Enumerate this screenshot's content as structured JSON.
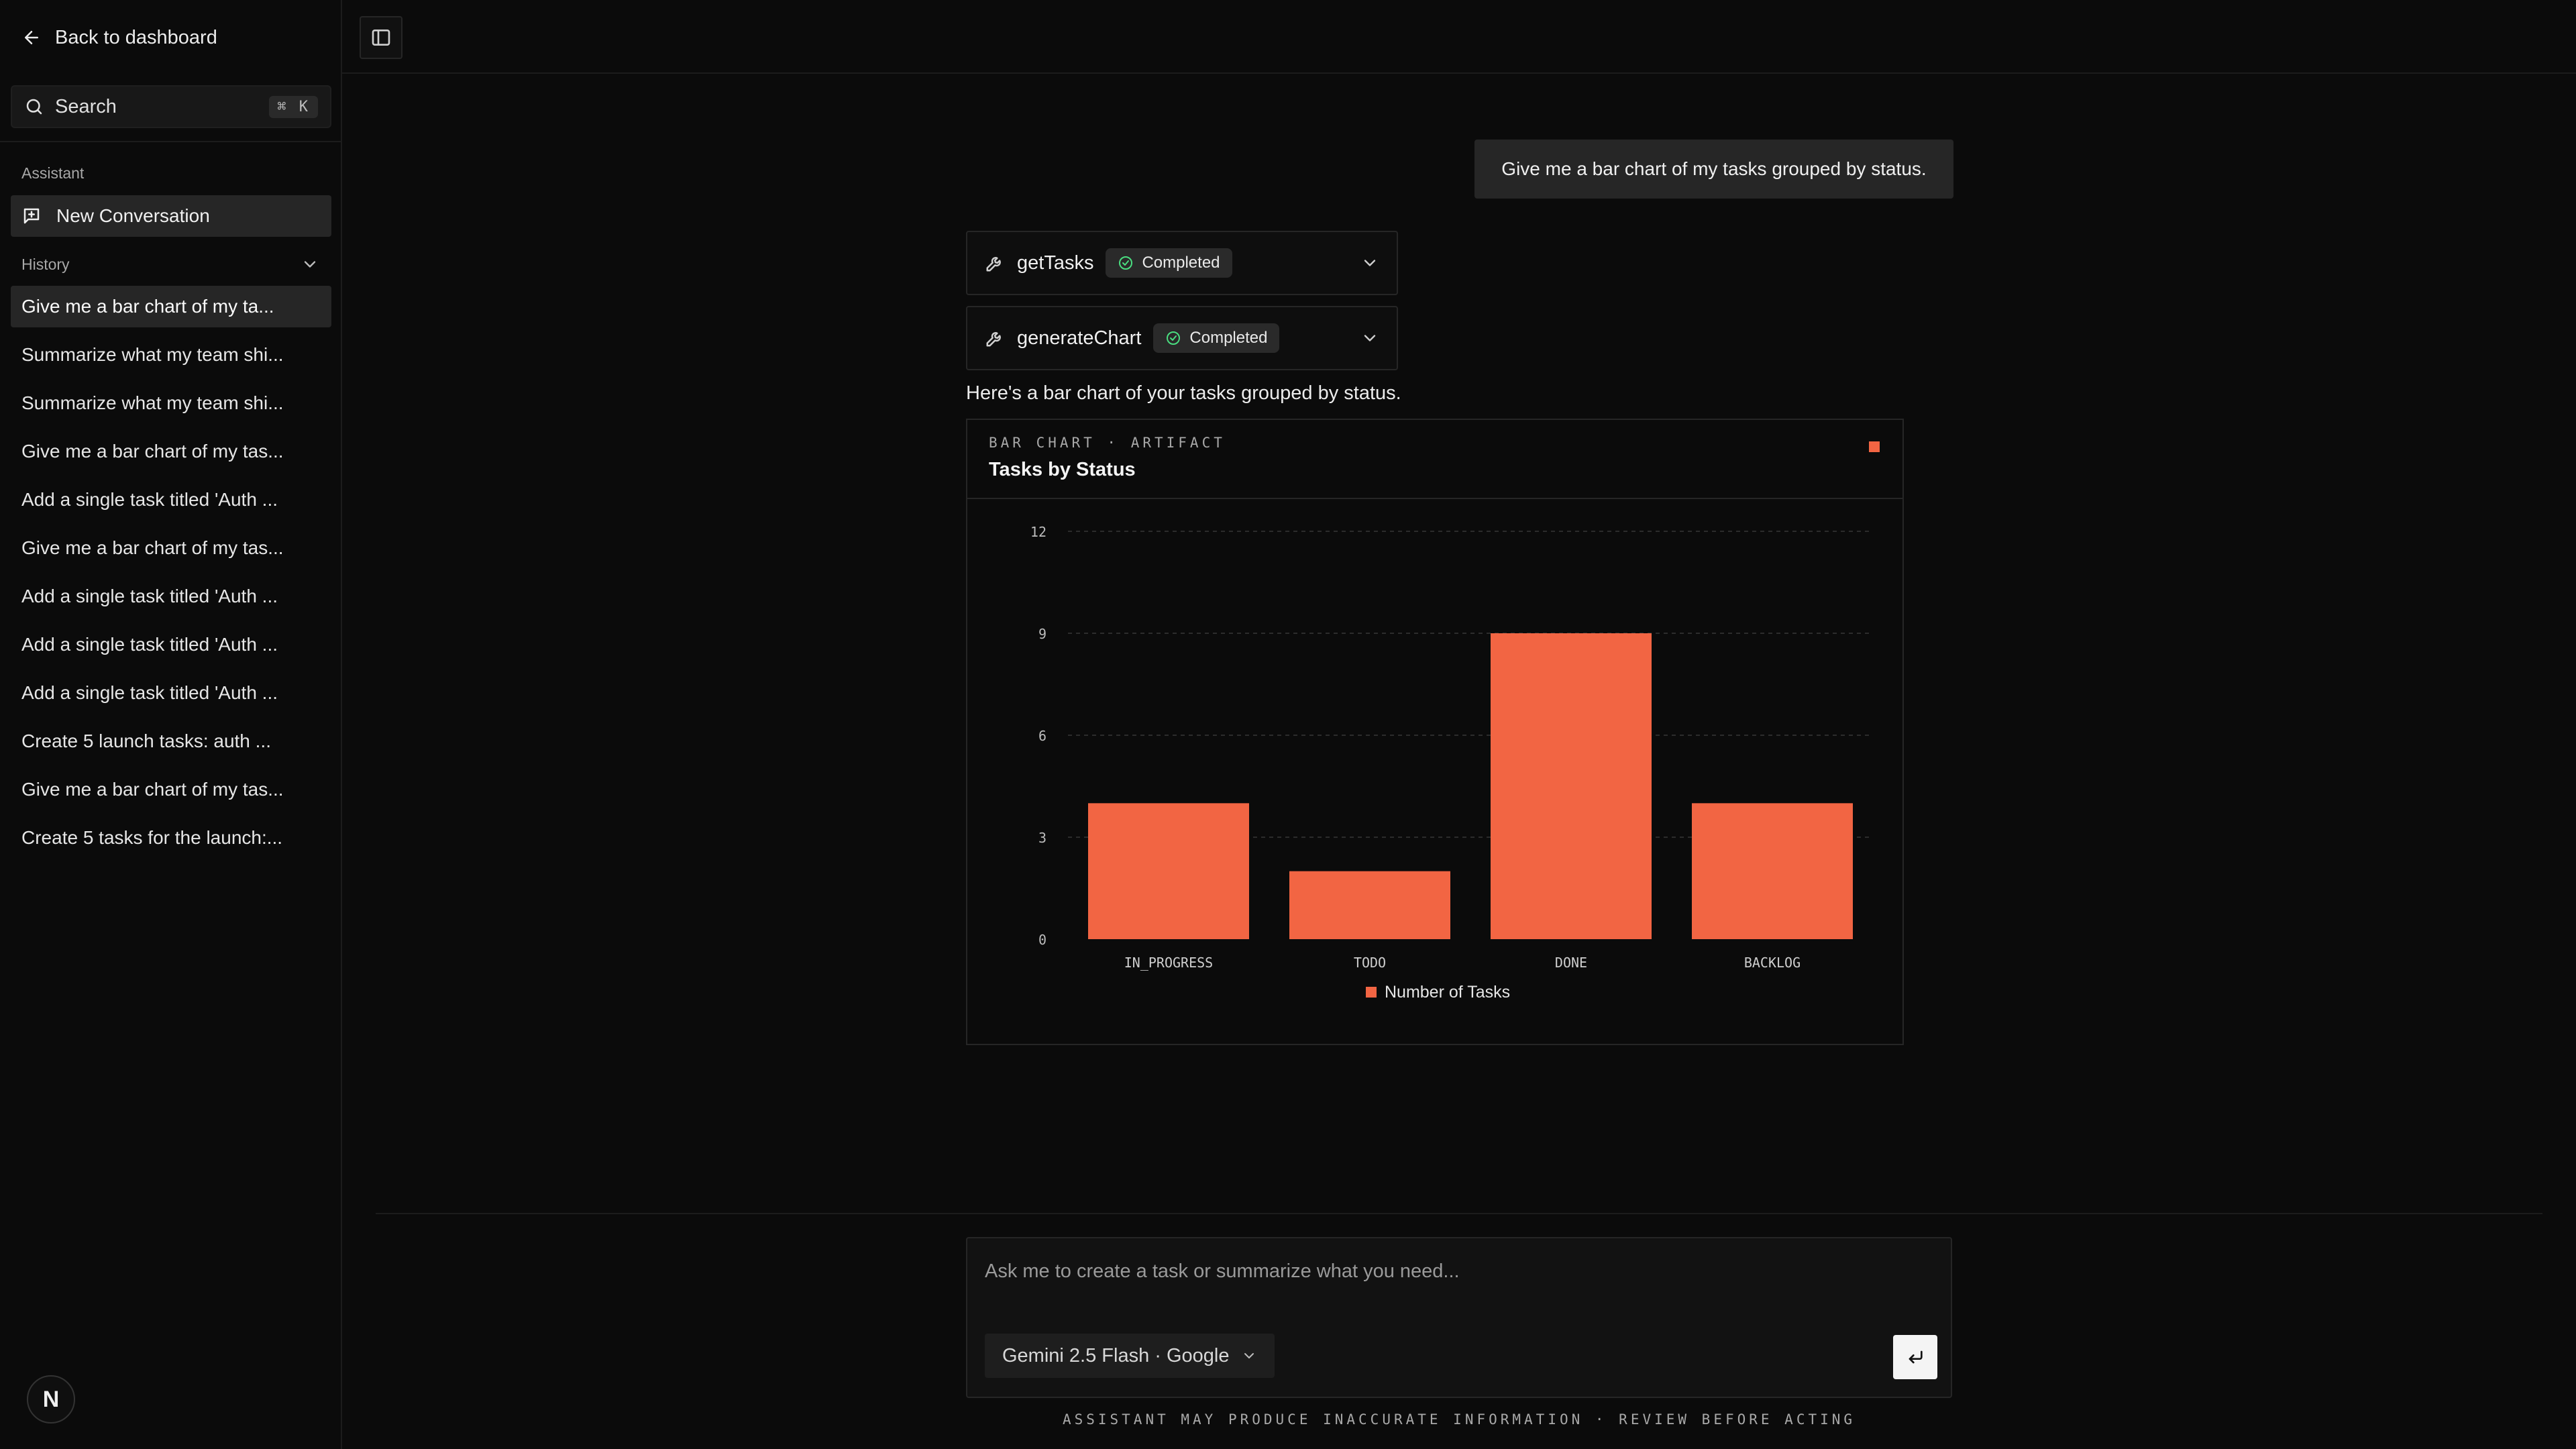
{
  "sidebar": {
    "back_label": "Back to dashboard",
    "search_label": "Search",
    "search_shortcut": "⌘ K",
    "assistant_section": "Assistant",
    "new_conversation": "New Conversation",
    "history_section": "History",
    "history": [
      "Give me a bar chart of my ta...",
      "Summarize what my team shi...",
      "Summarize what my team shi...",
      "Give me a bar chart of my tas...",
      "Add a single task titled 'Auth ...",
      "Give me a bar chart of my tas...",
      "Add a single task titled 'Auth ...",
      "Add a single task titled 'Auth ...",
      "Add a single task titled 'Auth ...",
      "Create 5 launch tasks: auth ...",
      "Give me a bar chart of my tas...",
      "Create 5 tasks for the launch:..."
    ],
    "logo_letter": "N"
  },
  "chat": {
    "user_message": "Give me a bar chart of my tasks grouped by status.",
    "tools": [
      {
        "name": "getTasks",
        "status": "Completed"
      },
      {
        "name": "generateChart",
        "status": "Completed"
      }
    ],
    "assistant_message": "Here's a bar chart of your tasks grouped by status."
  },
  "artifact": {
    "kicker": "BAR CHART · ARTIFACT",
    "title": "Tasks by Status"
  },
  "chart_data": {
    "type": "bar",
    "title": "Tasks by Status",
    "categories": [
      "IN_PROGRESS",
      "TODO",
      "DONE",
      "BACKLOG"
    ],
    "series": [
      {
        "name": "Number of Tasks",
        "values": [
          4,
          2,
          9,
          4
        ]
      }
    ],
    "y_ticks": [
      0,
      3,
      6,
      9,
      12
    ],
    "ylim": [
      0,
      12
    ],
    "grid": true,
    "legend_position": "bottom",
    "color": "#f26543"
  },
  "composer": {
    "placeholder": "Ask me to create a task or summarize what you need...",
    "model": "Gemini 2.5 Flash · Google",
    "disclaimer": "ASSISTANT MAY PRODUCE INACCURATE INFORMATION · REVIEW BEFORE ACTING"
  },
  "colors": {
    "accent": "#f26543",
    "background": "#0b0b0b"
  }
}
